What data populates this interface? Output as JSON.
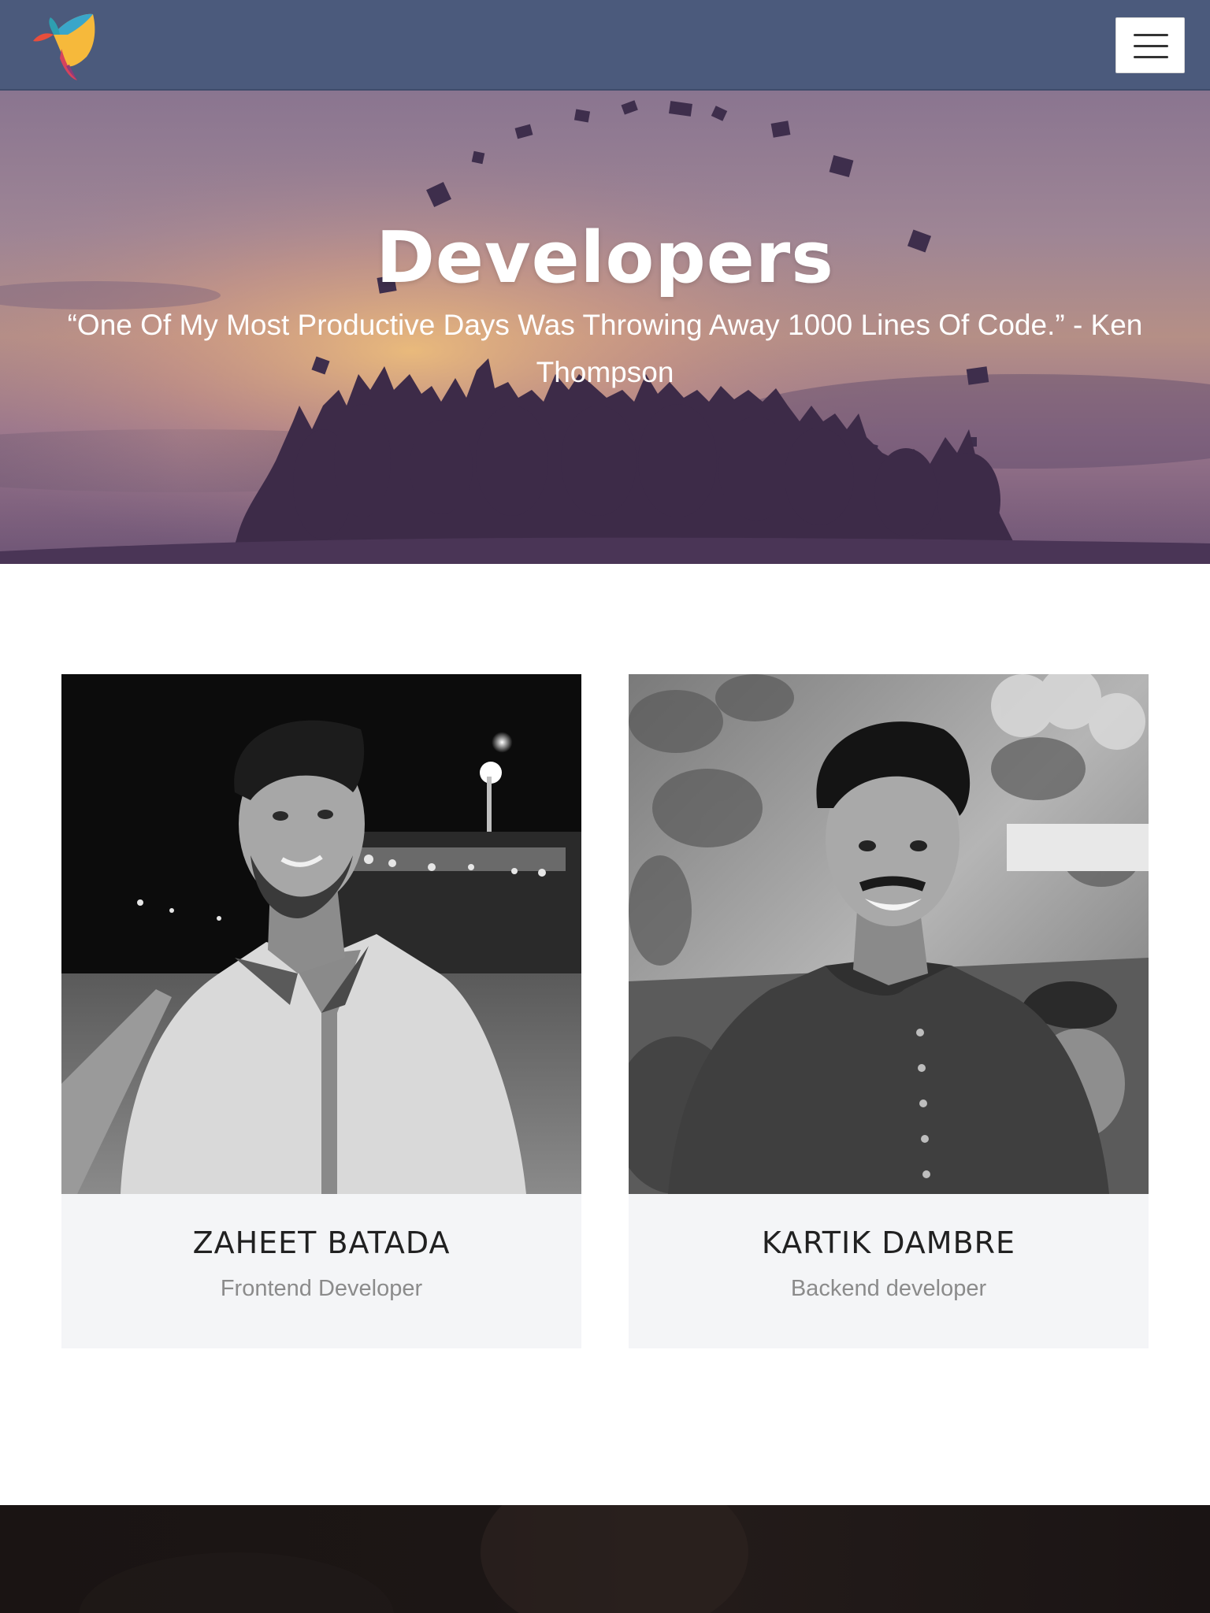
{
  "navbar": {
    "logo_icon": "butterfly-logo-icon",
    "menu_icon": "hamburger-menu-icon",
    "background": "#4b5a7c"
  },
  "hero": {
    "title": "Developers",
    "quote": "“One Of My Most Productive Days Was Throwing Away 1000 Lines Of Code.” - Ken Thompson"
  },
  "developers": [
    {
      "name": "ZAHEET BATADA",
      "role": "Frontend Developer"
    },
    {
      "name": "KARTIK DAMBRE",
      "role": "Backend developer"
    }
  ],
  "colors": {
    "card_background": "#f4f5f7",
    "name_text": "#212121",
    "role_text": "#8b8b8b"
  }
}
